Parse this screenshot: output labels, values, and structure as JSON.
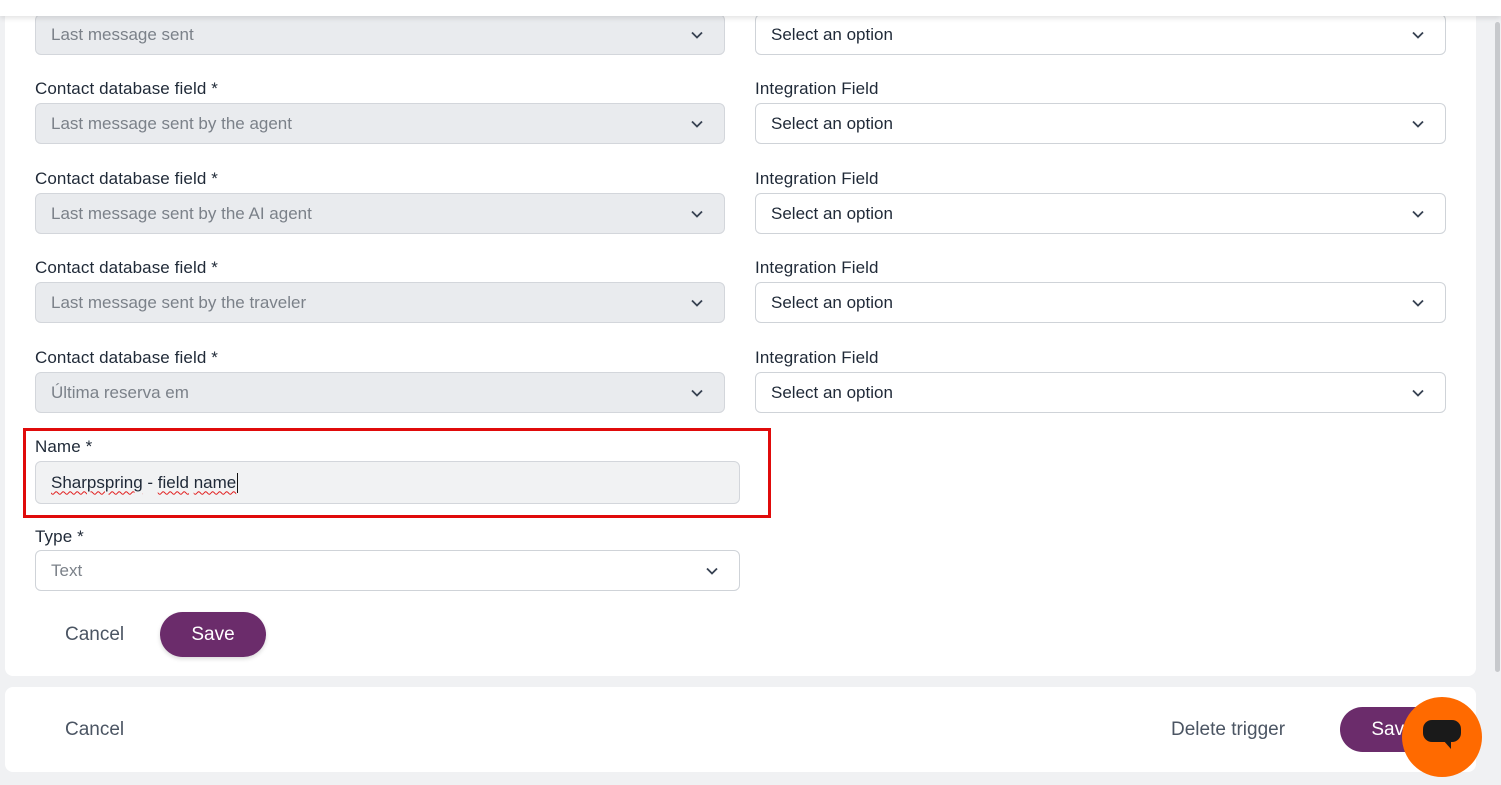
{
  "mapping_rows": [
    {
      "db_label": "",
      "db_value": "Last message sent",
      "int_label": "",
      "int_value": "Select an option"
    },
    {
      "db_label": "Contact database field *",
      "db_value": "Last message sent by the agent",
      "int_label": "Integration Field",
      "int_value": "Select an option"
    },
    {
      "db_label": "Contact database field *",
      "db_value": "Last message sent by the AI agent",
      "int_label": "Integration Field",
      "int_value": "Select an option"
    },
    {
      "db_label": "Contact database field *",
      "db_value": "Last message sent by the traveler",
      "int_label": "Integration Field",
      "int_value": "Select an option"
    },
    {
      "db_label": "Contact database field *",
      "db_value": "Última reserva em",
      "int_label": "Integration Field",
      "int_value": "Select an option"
    }
  ],
  "name_field": {
    "label": "Name *",
    "value_part1": "Sharpspring",
    "value_part2": " - ",
    "value_part3": "field",
    "value_part4": " ",
    "value_part5": "name"
  },
  "type_field": {
    "label": "Type *",
    "value": "Text"
  },
  "form_actions": {
    "cancel": "Cancel",
    "save": "Save"
  },
  "footer": {
    "cancel": "Cancel",
    "delete": "Delete trigger",
    "save": "Save"
  },
  "colors": {
    "primary": "#6b2c6b",
    "highlight": "#e00b0b",
    "chat": "#ff6a00"
  },
  "icons": {
    "select": "chevron-down-icon",
    "chat": "chat-icon"
  }
}
